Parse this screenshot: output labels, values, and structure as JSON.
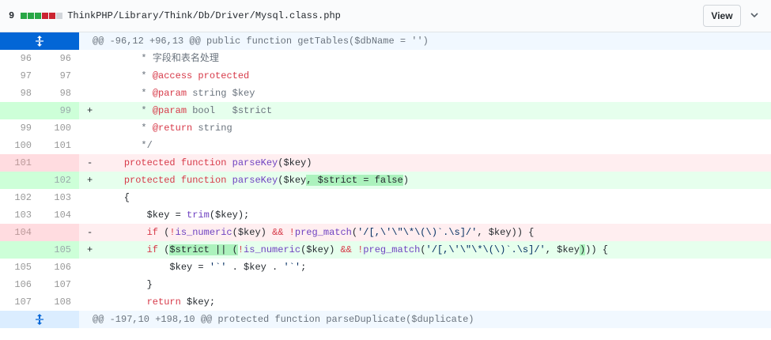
{
  "header": {
    "changes_count": "9",
    "stat_colors": [
      "#28a745",
      "#28a745",
      "#28a745",
      "#cb2431",
      "#cb2431",
      "#d1d5da"
    ],
    "file_path": "ThinkPHP/Library/Think/Db/Driver/Mysql.class.php",
    "view_label": "View",
    "chevron_icon": "chevron-down-icon"
  },
  "diff": {
    "hunk1": "@@ -96,12 +96,13 @@ public function getTables($dbName = '')",
    "hunk2": "@@ -197,10 +198,10 @@ protected function parseDuplicate($duplicate)",
    "expand_icon": "unfold-icon",
    "lines": [
      {
        "type": "ctx",
        "old": "96",
        "new": "96",
        "marker": "",
        "segments": [
          {
            "t": "       * ",
            "c": "c"
          },
          {
            "t": "字段和表名处理",
            "c": "c"
          }
        ]
      },
      {
        "type": "ctx",
        "old": "97",
        "new": "97",
        "marker": "",
        "segments": [
          {
            "t": "       * ",
            "c": "c"
          },
          {
            "t": "@access",
            "c": "k"
          },
          {
            "t": " protected",
            "c": "k"
          }
        ]
      },
      {
        "type": "ctx",
        "old": "98",
        "new": "98",
        "marker": "",
        "segments": [
          {
            "t": "       * ",
            "c": "c"
          },
          {
            "t": "@param",
            "c": "k"
          },
          {
            "t": " string $key",
            "c": "c"
          }
        ]
      },
      {
        "type": "add",
        "old": "",
        "new": "99",
        "marker": "+",
        "segments": [
          {
            "t": "       * ",
            "c": "c"
          },
          {
            "t": "@param",
            "c": "k"
          },
          {
            "t": " bool   $strict",
            "c": "c"
          }
        ]
      },
      {
        "type": "ctx",
        "old": "99",
        "new": "100",
        "marker": "",
        "segments": [
          {
            "t": "       * ",
            "c": "c"
          },
          {
            "t": "@return",
            "c": "k"
          },
          {
            "t": " string",
            "c": "c"
          }
        ]
      },
      {
        "type": "ctx",
        "old": "100",
        "new": "101",
        "marker": "",
        "segments": [
          {
            "t": "       */",
            "c": "c"
          }
        ]
      },
      {
        "type": "del",
        "old": "101",
        "new": "",
        "marker": "-",
        "segments": [
          {
            "t": "    ",
            "c": ""
          },
          {
            "t": "protected",
            "c": "k"
          },
          {
            "t": " ",
            "c": ""
          },
          {
            "t": "function",
            "c": "k"
          },
          {
            "t": " ",
            "c": ""
          },
          {
            "t": "parseKey",
            "c": "f"
          },
          {
            "t": "($key)",
            "c": ""
          }
        ]
      },
      {
        "type": "add",
        "old": "",
        "new": "102",
        "marker": "+",
        "segments": [
          {
            "t": "    ",
            "c": ""
          },
          {
            "t": "protected",
            "c": "k"
          },
          {
            "t": " ",
            "c": ""
          },
          {
            "t": "function",
            "c": "k"
          },
          {
            "t": " ",
            "c": ""
          },
          {
            "t": "parseKey",
            "c": "f"
          },
          {
            "t": "($key",
            "c": ""
          },
          {
            "t": ", $strict = false",
            "c": "",
            "hl": true
          },
          {
            "t": ")",
            "c": ""
          }
        ]
      },
      {
        "type": "ctx",
        "old": "102",
        "new": "103",
        "marker": "",
        "segments": [
          {
            "t": "    {",
            "c": ""
          }
        ]
      },
      {
        "type": "ctx",
        "old": "103",
        "new": "104",
        "marker": "",
        "segments": [
          {
            "t": "        $key = ",
            "c": ""
          },
          {
            "t": "trim",
            "c": "f"
          },
          {
            "t": "($key);",
            "c": ""
          }
        ]
      },
      {
        "type": "del",
        "old": "104",
        "new": "",
        "marker": "-",
        "segments": [
          {
            "t": "        ",
            "c": ""
          },
          {
            "t": "if",
            "c": "k"
          },
          {
            "t": " (",
            "c": ""
          },
          {
            "t": "!",
            "c": "k"
          },
          {
            "t": "is_numeric",
            "c": "f"
          },
          {
            "t": "($key) ",
            "c": ""
          },
          {
            "t": "&&",
            "c": "k"
          },
          {
            "t": " ",
            "c": ""
          },
          {
            "t": "!",
            "c": "k"
          },
          {
            "t": "preg_match",
            "c": "f"
          },
          {
            "t": "(",
            "c": ""
          },
          {
            "t": "'/[,\\'\\\"\\*\\(\\)`.\\s]/'",
            "c": "s"
          },
          {
            "t": ", $key)) {",
            "c": ""
          }
        ]
      },
      {
        "type": "add",
        "old": "",
        "new": "105",
        "marker": "+",
        "segments": [
          {
            "t": "        ",
            "c": ""
          },
          {
            "t": "if",
            "c": "k"
          },
          {
            "t": " (",
            "c": ""
          },
          {
            "t": "$strict || (",
            "c": "",
            "hl": true
          },
          {
            "t": "!",
            "c": "k"
          },
          {
            "t": "is_numeric",
            "c": "f"
          },
          {
            "t": "($key) ",
            "c": ""
          },
          {
            "t": "&&",
            "c": "k"
          },
          {
            "t": " ",
            "c": ""
          },
          {
            "t": "!",
            "c": "k"
          },
          {
            "t": "preg_match",
            "c": "f"
          },
          {
            "t": "(",
            "c": ""
          },
          {
            "t": "'/[,\\'\\\"\\*\\(\\)`.\\s]/'",
            "c": "s"
          },
          {
            "t": ", $key",
            "c": ""
          },
          {
            "t": ")",
            "c": "",
            "hl": true
          },
          {
            "t": ")) {",
            "c": ""
          }
        ]
      },
      {
        "type": "ctx",
        "old": "105",
        "new": "106",
        "marker": "",
        "segments": [
          {
            "t": "            $key = ",
            "c": ""
          },
          {
            "t": "'`'",
            "c": "s"
          },
          {
            "t": " . $key . ",
            "c": ""
          },
          {
            "t": "'`'",
            "c": "s"
          },
          {
            "t": ";",
            "c": ""
          }
        ]
      },
      {
        "type": "ctx",
        "old": "106",
        "new": "107",
        "marker": "",
        "segments": [
          {
            "t": "        }",
            "c": ""
          }
        ]
      },
      {
        "type": "ctx",
        "old": "107",
        "new": "108",
        "marker": "",
        "segments": [
          {
            "t": "        ",
            "c": ""
          },
          {
            "t": "return",
            "c": "k"
          },
          {
            "t": " $key;",
            "c": ""
          }
        ]
      }
    ]
  }
}
